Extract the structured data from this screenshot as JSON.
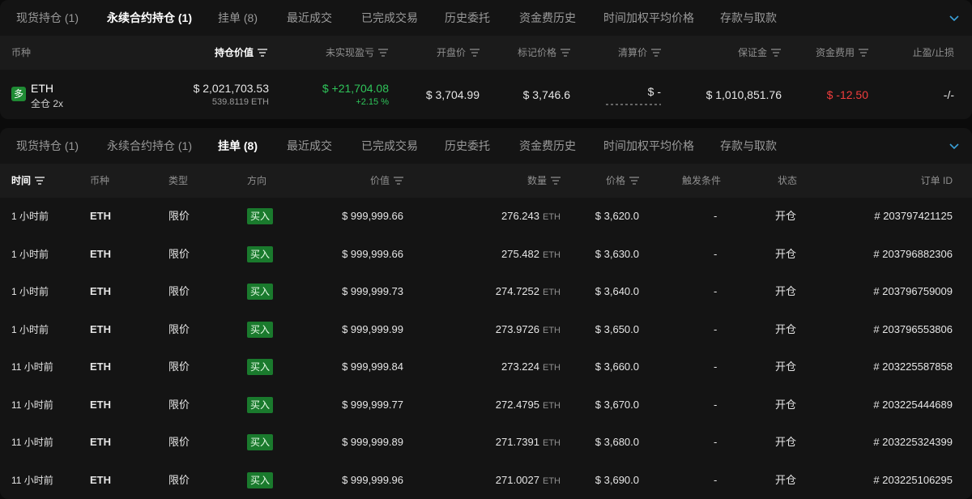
{
  "tabs": [
    "现货持仓 (1)",
    "永续合约持仓 (1)",
    "挂单 (8)",
    "最近成交",
    "已完成交易",
    "历史委托",
    "资金费历史",
    "时间加权平均价格",
    "存款与取款"
  ],
  "positions": {
    "active_tab": "永续合约持仓 (1)",
    "headers": {
      "coin": "币种",
      "value": "持仓价值",
      "unrealized_pnl": "未实现盈亏",
      "entry_price": "开盘价",
      "mark_price": "标记价格",
      "liq_price": "清算价",
      "margin": "保证金",
      "funding": "资金费用",
      "tp_sl": "止盈/止损"
    },
    "row": {
      "side_badge": "多",
      "coin": "ETH",
      "leverage": "全仓 2x",
      "value": "$ 2,021,703.53",
      "size": "539.8119 ETH",
      "pnl": "$ +21,704.08",
      "pnl_pct": "+2.15 %",
      "entry_price": "$ 3,704.99",
      "mark_price": "$ 3,746.6",
      "liq_price": "$ -",
      "margin": "$ 1,010,851.76",
      "funding": "$ -12.50",
      "tp_sl": "-/-"
    }
  },
  "orders": {
    "active_tab": "挂单 (8)",
    "headers": {
      "time": "时间",
      "coin": "币种",
      "type": "类型",
      "direction": "方向",
      "value": "价值",
      "size": "数量",
      "price": "价格",
      "trigger": "触发条件",
      "status": "状态",
      "order_id": "订单 ID"
    },
    "rows": [
      {
        "time": "1 小时前",
        "coin": "ETH",
        "type": "限价",
        "direction": "买入",
        "value": "$ 999,999.66",
        "size": "276.243",
        "unit": "ETH",
        "price": "$ 3,620.0",
        "trigger": "-",
        "status": "开仓",
        "order_id": "# 203797421125"
      },
      {
        "time": "1 小时前",
        "coin": "ETH",
        "type": "限价",
        "direction": "买入",
        "value": "$ 999,999.66",
        "size": "275.482",
        "unit": "ETH",
        "price": "$ 3,630.0",
        "trigger": "-",
        "status": "开仓",
        "order_id": "# 203796882306"
      },
      {
        "time": "1 小时前",
        "coin": "ETH",
        "type": "限价",
        "direction": "买入",
        "value": "$ 999,999.73",
        "size": "274.7252",
        "unit": "ETH",
        "price": "$ 3,640.0",
        "trigger": "-",
        "status": "开仓",
        "order_id": "# 203796759009"
      },
      {
        "time": "1 小时前",
        "coin": "ETH",
        "type": "限价",
        "direction": "买入",
        "value": "$ 999,999.99",
        "size": "273.9726",
        "unit": "ETH",
        "price": "$ 3,650.0",
        "trigger": "-",
        "status": "开仓",
        "order_id": "# 203796553806"
      },
      {
        "time": "11 小时前",
        "coin": "ETH",
        "type": "限价",
        "direction": "买入",
        "value": "$ 999,999.84",
        "size": "273.224",
        "unit": "ETH",
        "price": "$ 3,660.0",
        "trigger": "-",
        "status": "开仓",
        "order_id": "# 203225587858"
      },
      {
        "time": "11 小时前",
        "coin": "ETH",
        "type": "限价",
        "direction": "买入",
        "value": "$ 999,999.77",
        "size": "272.4795",
        "unit": "ETH",
        "price": "$ 3,670.0",
        "trigger": "-",
        "status": "开仓",
        "order_id": "# 203225444689"
      },
      {
        "time": "11 小时前",
        "coin": "ETH",
        "type": "限价",
        "direction": "买入",
        "value": "$ 999,999.89",
        "size": "271.7391",
        "unit": "ETH",
        "price": "$ 3,680.0",
        "trigger": "-",
        "status": "开仓",
        "order_id": "# 203225324399"
      },
      {
        "time": "11 小时前",
        "coin": "ETH",
        "type": "限价",
        "direction": "买入",
        "value": "$ 999,999.96",
        "size": "271.0027",
        "unit": "ETH",
        "price": "$ 3,690.0",
        "trigger": "-",
        "status": "开仓",
        "order_id": "# 203225106295"
      }
    ]
  },
  "colors": {
    "background": "#0b0b0b",
    "panel": "#141414",
    "header_row": "#1b1b1b",
    "profit_green": "#2fc55a",
    "loss_red": "#f23d3d",
    "buy_badge": "#1a7a2d",
    "long_badge": "#1f8b34"
  },
  "icons": [
    "filter-icon",
    "chevron-down-icon"
  ]
}
